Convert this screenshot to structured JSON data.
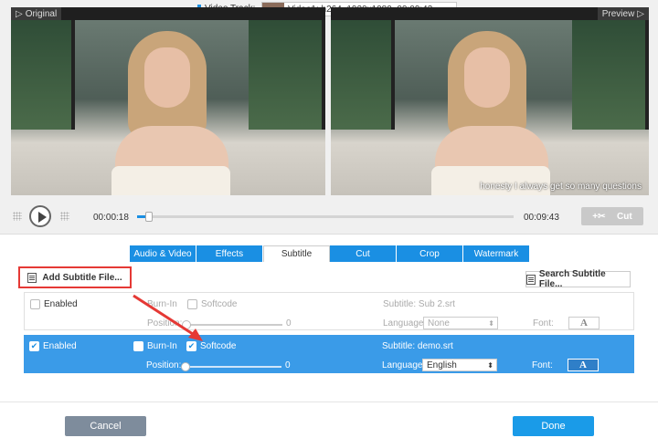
{
  "header": {
    "original_label": "Original",
    "preview_label": "Preview",
    "video_track_label": "Video Track:",
    "video_track_value": "Video1: h264, 1920x1080, 00:09:43"
  },
  "preview": {
    "subtitle_text": "honesty I always get so many questions"
  },
  "player": {
    "current_time": "00:00:18",
    "total_time": "00:09:43",
    "progress": 0.031,
    "cut_label": "Cut"
  },
  "tabs": [
    {
      "label": "Audio & Video"
    },
    {
      "label": "Effects"
    },
    {
      "label": "Subtitle",
      "active": true
    },
    {
      "label": "Cut"
    },
    {
      "label": "Crop"
    },
    {
      "label": "Watermark"
    }
  ],
  "subtitle_panel": {
    "add_button": "Add Subtitle File...",
    "search_button": "Search Subtitle File...",
    "rows": [
      {
        "enabled_label": "Enabled",
        "enabled_checked": false,
        "burnin_label": "Burn-In",
        "softcode_label": "Softcode",
        "subtitle_text": "Subtitle: Sub 2.srt",
        "position_label": "Position:",
        "position_value": "0",
        "language_label": "Language:",
        "language_value": "None",
        "font_label": "Font:",
        "font_glyph": "A"
      },
      {
        "enabled_label": "Enabled",
        "enabled_checked": true,
        "burnin_label": "Burn-In",
        "burnin_checked": false,
        "softcode_label": "Softcode",
        "softcode_checked": true,
        "subtitle_text": "Subtitle: demo.srt",
        "position_label": "Position:",
        "position_value": "0",
        "language_label": "Language:",
        "language_value": "English",
        "font_label": "Font:",
        "font_glyph": "A"
      }
    ]
  },
  "footer": {
    "cancel_label": "Cancel",
    "done_label": "Done"
  },
  "colors": {
    "accent": "#1a8fe3",
    "highlight_row": "#3a9be8",
    "callout": "#e53935",
    "cancel": "#7e8c9c"
  }
}
